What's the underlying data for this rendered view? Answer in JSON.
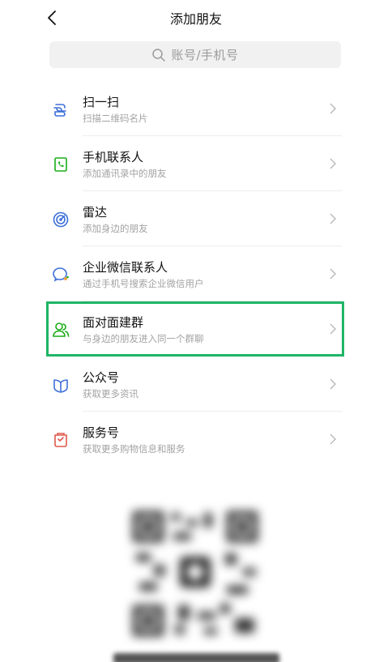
{
  "header": {
    "title": "添加朋友",
    "back_icon": "chevron-left-icon"
  },
  "search": {
    "placeholder": "账号/手机号",
    "icon": "search-icon"
  },
  "items": [
    {
      "title": "扫一扫",
      "subtitle": "扫描二维码名片",
      "icon": "scan-icon",
      "color": "#3d6fd8"
    },
    {
      "title": "手机联系人",
      "subtitle": "添加通讯录中的朋友",
      "icon": "phone-contacts-icon",
      "color": "#1aad19"
    },
    {
      "title": "雷达",
      "subtitle": "添加身边的朋友",
      "icon": "radar-icon",
      "color": "#3d6fd8"
    },
    {
      "title": "企业微信联系人",
      "subtitle": "通过手机号搜索企业微信用户",
      "icon": "work-chat-icon",
      "color": "#3d6fd8"
    },
    {
      "title": "面对面建群",
      "subtitle": "与身边的朋友进入同一个群聊",
      "icon": "face-to-face-group-icon",
      "color": "#1aad19"
    },
    {
      "title": "公众号",
      "subtitle": "获取更多资讯",
      "icon": "official-accounts-icon",
      "color": "#3d6fd8"
    },
    {
      "title": "服务号",
      "subtitle": "获取更多购物信息和服务",
      "icon": "service-accounts-icon",
      "color": "#e0584b"
    }
  ],
  "colors": {
    "accent": "#1fb566",
    "subtitle": "#a3a3a3"
  }
}
